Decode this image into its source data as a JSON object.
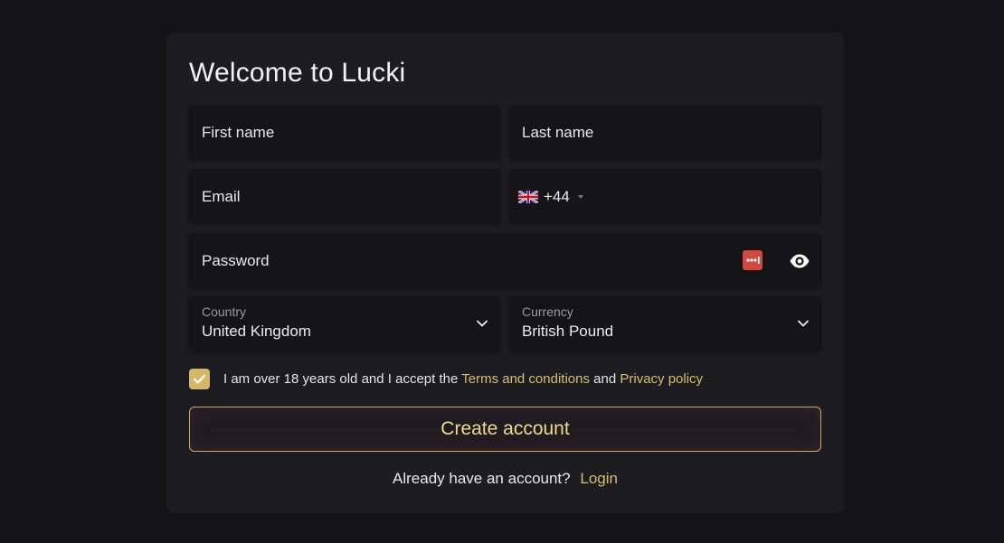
{
  "form": {
    "title": "Welcome to Lucki",
    "first_name_placeholder": "First name",
    "last_name_placeholder": "Last name",
    "email_placeholder": "Email",
    "phone_dial_code": "+44",
    "phone_flag": "uk-flag-icon",
    "password_placeholder": "Password",
    "country": {
      "label": "Country",
      "value": "United Kingdom"
    },
    "currency": {
      "label": "Currency",
      "value": "British Pound"
    },
    "agree": {
      "checked": true,
      "text_before": "I am over 18 years old and I accept the",
      "terms_link": "Terms and conditions",
      "text_mid": "and",
      "privacy_link": "Privacy policy"
    },
    "submit_label": "Create account",
    "login_prompt": "Already have an account?",
    "login_link": "Login"
  },
  "colors": {
    "background": "#141316",
    "card": "#1d1c20",
    "field": "#151417",
    "accent_gold": "#d4b86a",
    "button_text": "#f0d88d",
    "password_manager_icon": "#d14a42"
  }
}
